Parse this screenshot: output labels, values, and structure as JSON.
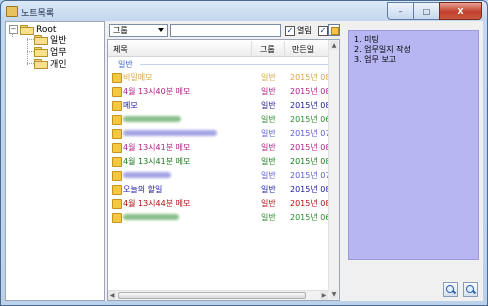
{
  "window": {
    "title": "노트목록"
  },
  "titlebar_buttons": {
    "minimize": "–",
    "maximize": "□",
    "close": "X"
  },
  "tree": {
    "root": "Root",
    "children": [
      "일반",
      "업무",
      "개인"
    ]
  },
  "toolbar": {
    "category_select": "그룹",
    "search_value": "",
    "open_checkbox_label": "열림",
    "open_checked": true,
    "second_checked": true
  },
  "list": {
    "columns": [
      "제목",
      "그룹",
      "만든일"
    ],
    "group_header": "일반",
    "rows": [
      {
        "title": "비밀메모",
        "category": "일반",
        "date": "2015년 08월",
        "color": "#d4a64a",
        "blurred": false
      },
      {
        "title": "4월 13시40분 메모",
        "category": "일반",
        "date": "2015년 08월",
        "color": "#b0208a",
        "blurred": false
      },
      {
        "title": "메모",
        "category": "일반",
        "date": "2015년 08월",
        "color": "#1a1a9a",
        "blurred": false
      },
      {
        "title": "",
        "category": "일반",
        "date": "2015년 06월",
        "color": "#2a8a2a",
        "blurred": true,
        "blur_w": 58
      },
      {
        "title": "",
        "category": "일반",
        "date": "2015년 07월",
        "color": "#5a5ad0",
        "blurred": true,
        "blur_w": 94
      },
      {
        "title": "4월 13시41분 메모",
        "category": "일반",
        "date": "2015년 08월",
        "color": "#b0208a",
        "blurred": false
      },
      {
        "title": "4월 13시41분 메모",
        "category": "일반",
        "date": "2015년 08월",
        "color": "#1a7a1a",
        "blurred": false
      },
      {
        "title": "",
        "category": "일반",
        "date": "2015년 07월",
        "color": "#5a5ad0",
        "blurred": true,
        "blur_w": 48
      },
      {
        "title": "오늘의 할일",
        "category": "일반",
        "date": "2015년 08월",
        "color": "#1a1a9a",
        "blurred": false
      },
      {
        "title": "4월 13시44분 메모",
        "category": "일반",
        "date": "2015년 08월",
        "color": "#b01010",
        "blurred": false
      },
      {
        "title": "",
        "category": "일반",
        "date": "2015년 06월",
        "color": "#2a8a2a",
        "blurred": true,
        "blur_w": 56
      }
    ]
  },
  "note": {
    "lines": [
      "1. 미팅",
      "2. 업무일지 작성",
      "3. 업무 보고"
    ]
  },
  "icons": [
    "app-icon",
    "folder-icon",
    "magnifier-icon",
    "checkbox-icon"
  ]
}
